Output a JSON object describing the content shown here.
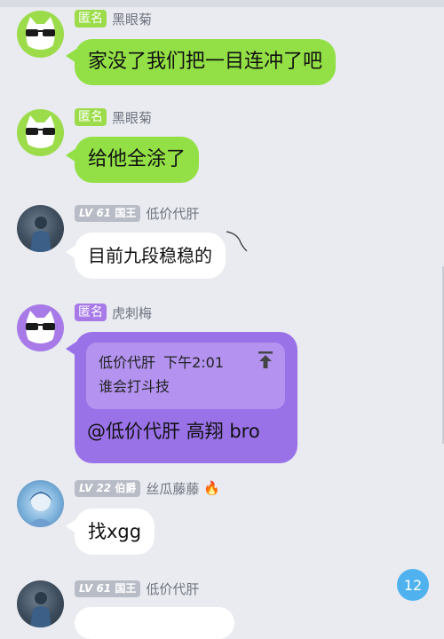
{
  "messages": [
    {
      "tag": "匿名",
      "tag_color": "#9cdc4a",
      "name": "黑眼菊",
      "text": "家没了我们把一目连冲了吧"
    },
    {
      "tag": "匿名",
      "tag_color": "#9cdc4a",
      "name": "黑眼菊",
      "text": "给他全涂了"
    },
    {
      "level": "LV 61",
      "title": "国王",
      "name": "低价代肝",
      "text": "目前九段稳稳的"
    },
    {
      "tag": "匿名",
      "tag_color": "#a77ae8",
      "name": "虎刺梅",
      "quote": {
        "author": "低价代肝",
        "time": "下午2:01",
        "text": "谁会打斗技"
      },
      "text": "@低价代肝 高翔 bro"
    },
    {
      "level": "LV 22",
      "title": "伯爵",
      "name": "丝瓜藤藤",
      "flame": "🔥",
      "text": "找xgg"
    },
    {
      "level": "LV 61",
      "title": "国王",
      "name": "低价代肝"
    }
  ],
  "unread_count": "12",
  "colors": {
    "green_bubble": "#93e046",
    "purple_bubble": "#9a72e8",
    "unread_badge": "#4fb2ef"
  }
}
